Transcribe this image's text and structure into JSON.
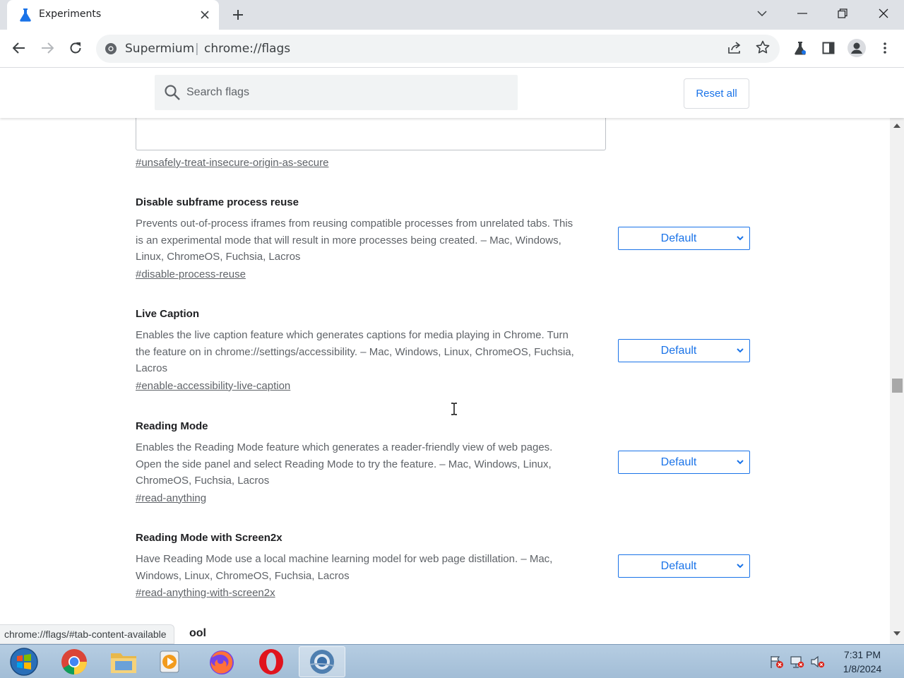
{
  "browser": {
    "tab_title": "Experiments",
    "site_name": "Supermium",
    "url_separator": "|",
    "url": "chrome://flags"
  },
  "flags_header": {
    "search_placeholder": "Search flags",
    "reset_all_label": "Reset all"
  },
  "content": {
    "previous_flag_link": "#unsafely-treat-insecure-origin-as-secure",
    "experiments": [
      {
        "name": "Disable subframe process reuse",
        "description_lines": [
          "Prevents out-of-process iframes from reusing compatible processes from unrelated tabs. This",
          "is an experimental mode that will result in more processes being created. – Mac, Windows,",
          "Linux, ChromeOS, Fuchsia, Lacros"
        ],
        "tag": "#disable-process-reuse",
        "selected": "Default"
      },
      {
        "name": "Live Caption",
        "description_lines": [
          "Enables the live caption feature which generates captions for media playing in Chrome. Turn",
          "the feature on in chrome://settings/accessibility. – Mac, Windows, Linux, ChromeOS, Fuchsia,",
          "Lacros"
        ],
        "tag": "#enable-accessibility-live-caption",
        "selected": "Default"
      },
      {
        "name": "Reading Mode",
        "description_lines": [
          "Enables the Reading Mode feature which generates a reader-friendly view of web pages.",
          "Open the side panel and select Reading Mode to try the feature. – Mac, Windows, Linux,",
          "ChromeOS, Fuchsia, Lacros"
        ],
        "tag": "#read-anything",
        "selected": "Default"
      },
      {
        "name": "Reading Mode with Screen2x",
        "description_lines": [
          "Have Reading Mode use a local machine learning model for web page distillation. – Mac,",
          "Windows, Linux, ChromeOS, Fuchsia, Lacros"
        ],
        "tag": "#read-anything-with-screen2x",
        "selected": "Default"
      }
    ],
    "partial_next_title": "ool"
  },
  "status_bubble": "chrome://flags/#tab-content-available",
  "taskbar": {
    "time": "7:31 PM",
    "date": "1/8/2024"
  },
  "colors": {
    "accent": "#1a73e8",
    "tabstrip": "#dee1e6",
    "taskbar": "#a9c3db"
  }
}
